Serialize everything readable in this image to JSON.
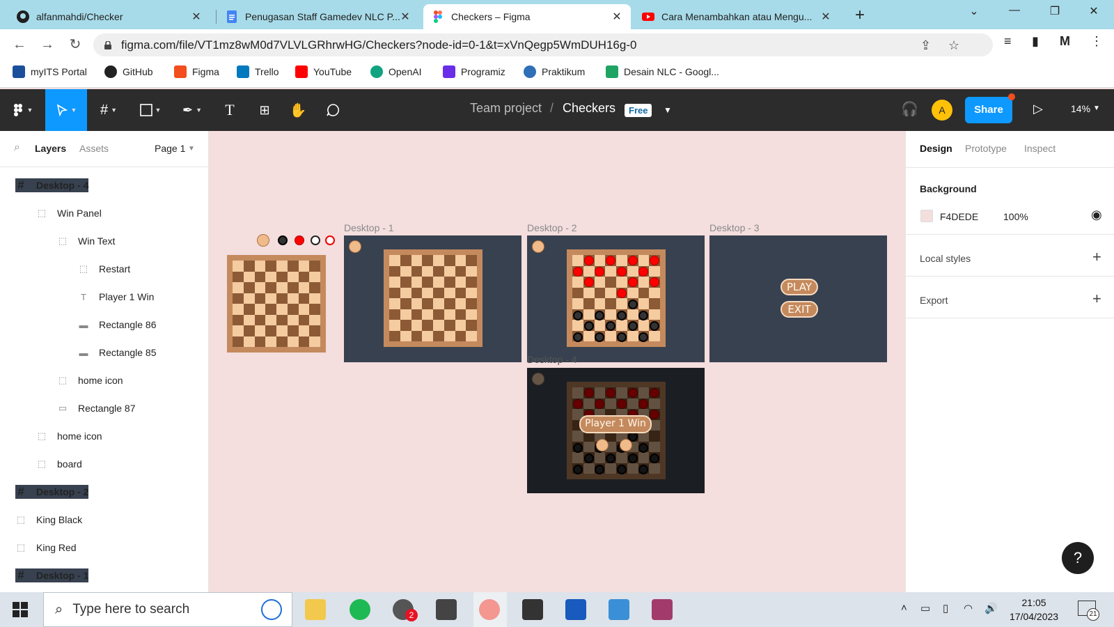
{
  "browser": {
    "tabs": [
      {
        "title": "alfanmahdi/Checker",
        "icon": "github-icon"
      },
      {
        "title": "Penugasan Staff Gamedev NLC P...",
        "icon": "google-docs-icon"
      },
      {
        "title": "Checkers – Figma",
        "icon": "figma-icon"
      },
      {
        "title": "Cara Menambahkan atau Mengu...",
        "icon": "youtube-icon"
      }
    ],
    "url": "figma.com/file/VT1mz8wM0d7VLVLGRhrwHG/Checkers?node-id=0-1&t=xVnQegp5WmDUH16g-0",
    "bookmarks": [
      {
        "label": "myITS Portal",
        "color": "#1b4f9c"
      },
      {
        "label": "GitHub",
        "color": "#222222"
      },
      {
        "label": "Figma",
        "color": "#f24e1e"
      },
      {
        "label": "Trello",
        "color": "#0079bf"
      },
      {
        "label": "YouTube",
        "color": "#ff0000"
      },
      {
        "label": "OpenAI",
        "color": "#10a37f"
      },
      {
        "label": "Programiz",
        "color": "#6a2de8"
      },
      {
        "label": "Praktikum",
        "color": "#2e6fb7"
      },
      {
        "label": "Desain NLC - Googl...",
        "color": "#1fa463"
      }
    ]
  },
  "figma": {
    "breadcrumb": {
      "project": "Team project",
      "separator": "/",
      "file": "Checkers",
      "badge": "Free"
    },
    "avatar": "A",
    "share_label": "Share",
    "zoom": "14%"
  },
  "layers_panel": {
    "tabs": {
      "layers": "Layers",
      "assets": "Assets",
      "page": "Page 1"
    },
    "items": [
      {
        "label": "Desktop - 4",
        "type": "frame",
        "indent": 0
      },
      {
        "label": "Win Panel",
        "type": "group",
        "indent": 1
      },
      {
        "label": "Win Text",
        "type": "group",
        "indent": 2
      },
      {
        "label": "Restart",
        "type": "group",
        "indent": 3
      },
      {
        "label": "Player 1 Win",
        "type": "text",
        "indent": 3
      },
      {
        "label": "Rectangle 86",
        "type": "line",
        "indent": 3
      },
      {
        "label": "Rectangle 85",
        "type": "line",
        "indent": 3
      },
      {
        "label": "home icon",
        "type": "group",
        "indent": 2
      },
      {
        "label": "Rectangle 87",
        "type": "rect",
        "indent": 2
      },
      {
        "label": "home icon",
        "type": "group",
        "indent": 1
      },
      {
        "label": "board",
        "type": "group",
        "indent": 1
      },
      {
        "label": "Desktop - 2",
        "type": "frame",
        "indent": 0
      },
      {
        "label": "King Black",
        "type": "group",
        "indent": 0
      },
      {
        "label": "King Red",
        "type": "group",
        "indent": 0
      },
      {
        "label": "Desktop - 1",
        "type": "frame",
        "indent": 0
      }
    ]
  },
  "design_panel": {
    "tabs": {
      "design": "Design",
      "prototype": "Prototype",
      "inspect": "Inspect"
    },
    "background_title": "Background",
    "background_hex": "F4DEDE",
    "background_opacity": "100%",
    "local_styles": "Local styles",
    "export": "Export",
    "help": "?"
  },
  "canvas": {
    "frames": {
      "d1": "Desktop - 1",
      "d2": "Desktop - 2",
      "d3": "Desktop - 3",
      "d4": "Desktop - 4"
    },
    "menu": {
      "play": "PLAY",
      "exit": "EXIT"
    },
    "win_text": "Player 1 Win"
  },
  "taskbar": {
    "search_placeholder": "Type here to search",
    "time": "21:05",
    "date": "17/04/2023",
    "notifications": "21",
    "whatsapp_badge": "2"
  }
}
